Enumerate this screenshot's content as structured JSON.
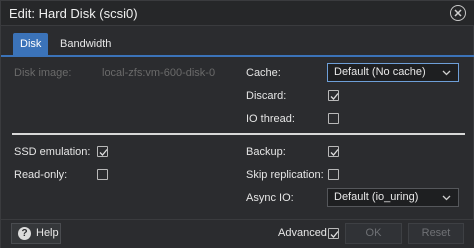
{
  "dialog": {
    "title": "Edit: Hard Disk (scsi0)"
  },
  "tabs": [
    {
      "label": "Disk",
      "active": true
    },
    {
      "label": "Bandwidth",
      "active": false
    }
  ],
  "left": {
    "disk_image_label": "Disk image:",
    "disk_image_value": "local-zfs:vm-600-disk-0",
    "ssd_label": "SSD emulation:",
    "ssd_checked": true,
    "readonly_label": "Read-only:",
    "readonly_checked": false
  },
  "right": {
    "cache_label": "Cache:",
    "cache_value": "Default (No cache)",
    "discard_label": "Discard:",
    "discard_checked": true,
    "iothread_label": "IO thread:",
    "iothread_checked": false,
    "backup_label": "Backup:",
    "backup_checked": true,
    "skiprep_label": "Skip replication:",
    "skiprep_checked": false,
    "asyncio_label": "Async IO:",
    "asyncio_value": "Default (io_uring)"
  },
  "footer": {
    "help_label": "Help",
    "advanced_label": "Advanced",
    "advanced_checked": true,
    "ok_label": "OK",
    "reset_label": "Reset"
  },
  "icons": {
    "close": "close-icon",
    "help": "help-icon",
    "chevron": "chevron-down-icon",
    "check": "check-icon"
  }
}
